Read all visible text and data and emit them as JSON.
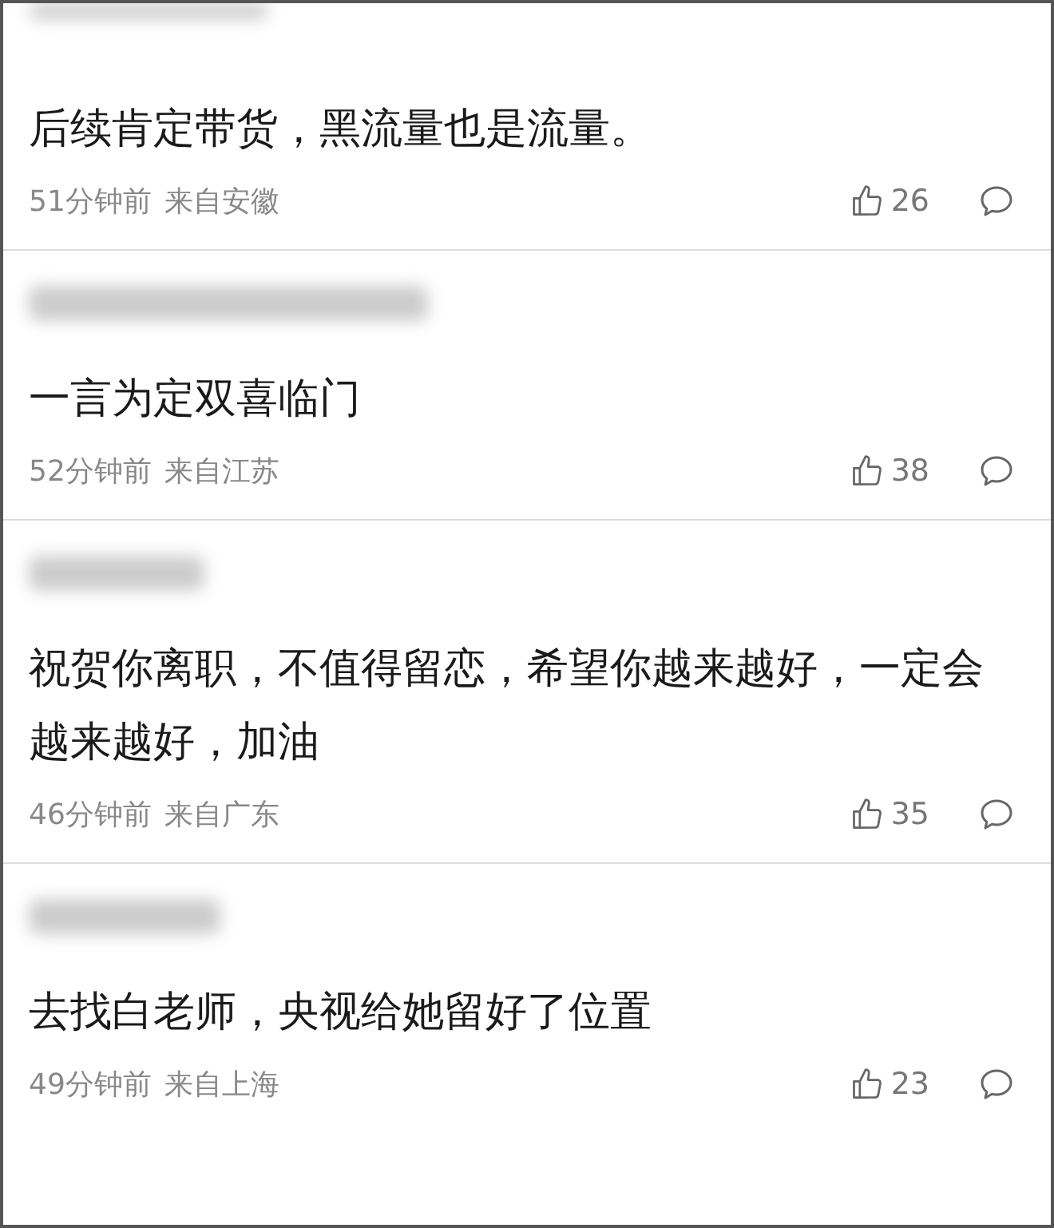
{
  "comments": [
    {
      "text": "后续肯定带货，黑流量也是流量。",
      "time": "51分钟前",
      "location": "来自安徽",
      "likes": "26"
    },
    {
      "text": "一言为定双喜临门",
      "time": "52分钟前",
      "location": "来自江苏",
      "likes": "38"
    },
    {
      "text": "祝贺你离职，不值得留恋，希望你越来越好，一定会越来越好，加油",
      "time": "46分钟前",
      "location": "来自广东",
      "likes": "35"
    },
    {
      "text": "去找白老师，央视给她留好了位置",
      "time": "49分钟前",
      "location": "来自上海",
      "likes": "23"
    }
  ]
}
